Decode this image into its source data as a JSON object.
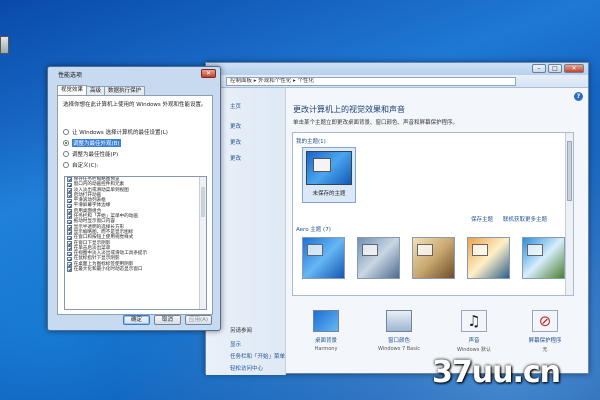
{
  "control_panel": {
    "address_path": "控制面板 ▸ 外观和个性化 ▸ 个性化",
    "sidebar_links": [
      "主页",
      "更改",
      "更改",
      "更改",
      "另请参阅",
      "显示",
      "任务栏和「开始」菜单",
      "轻松访问中心"
    ],
    "help_label": "?",
    "title": "更改计算机上的视觉效果和声音",
    "description": "单击某个主题立即更改桌面背景、窗口颜色、声音和屏幕保护程序。",
    "my_themes_label": "我的主题(1)",
    "unsaved_theme_label": "未保存的主题",
    "save_theme_link": "保存主题",
    "online_themes_link": "联机获取更多主题",
    "aero_themes_label": "Aero 主题 (7)",
    "bottom_items": [
      {
        "label": "桌面背景",
        "sub": "Harmony"
      },
      {
        "label": "窗口颜色",
        "sub": "Windows 7 Basic"
      },
      {
        "label": "声音",
        "sub": "Windows 默认"
      },
      {
        "label": "屏幕保护程序",
        "sub": "无"
      }
    ]
  },
  "perf_dialog": {
    "title": "性能选项",
    "close_label": "✕",
    "tabs": [
      "视觉效果",
      "高级",
      "数据执行保护"
    ],
    "description": "选择你想在此计算机上使用的 Windows 外观和性能设置。",
    "radio_options": [
      "让 Windows 选择计算机的最佳设置(L)",
      "调整为最佳外观(B)",
      "调整为最佳性能(P)",
      "自定义(C):"
    ],
    "selected_radio": 1,
    "effects": [
      "保存任务栏缩略图预览",
      "窗口内的动画控件和元素",
      "淡入淡出或滑动菜单到视图",
      "启动打开动画",
      "平滑滚动列表框",
      "平滑屏幕字体边缘",
      "启用桌面组合",
      "任务栏和「开始」菜单中的动画",
      "拖动时显示窗口内容",
      "显示半透明的选择长方形",
      "显示缩略图，而不是显示图标",
      "在窗口和按钮上使用视觉样式",
      "在窗口下显示阴影",
      "在单击后淡出菜单",
      "在视图中淡入淡出或滑动工具条提示",
      "在鼠标指针下显示阴影",
      "在桌面上为图标标签使用阴影",
      "在最大化和最小化时动态显示窗口"
    ],
    "buttons": {
      "ok": "确定",
      "cancel": "取消",
      "apply": "应用(A)"
    }
  },
  "watermark": "37uu.cn"
}
